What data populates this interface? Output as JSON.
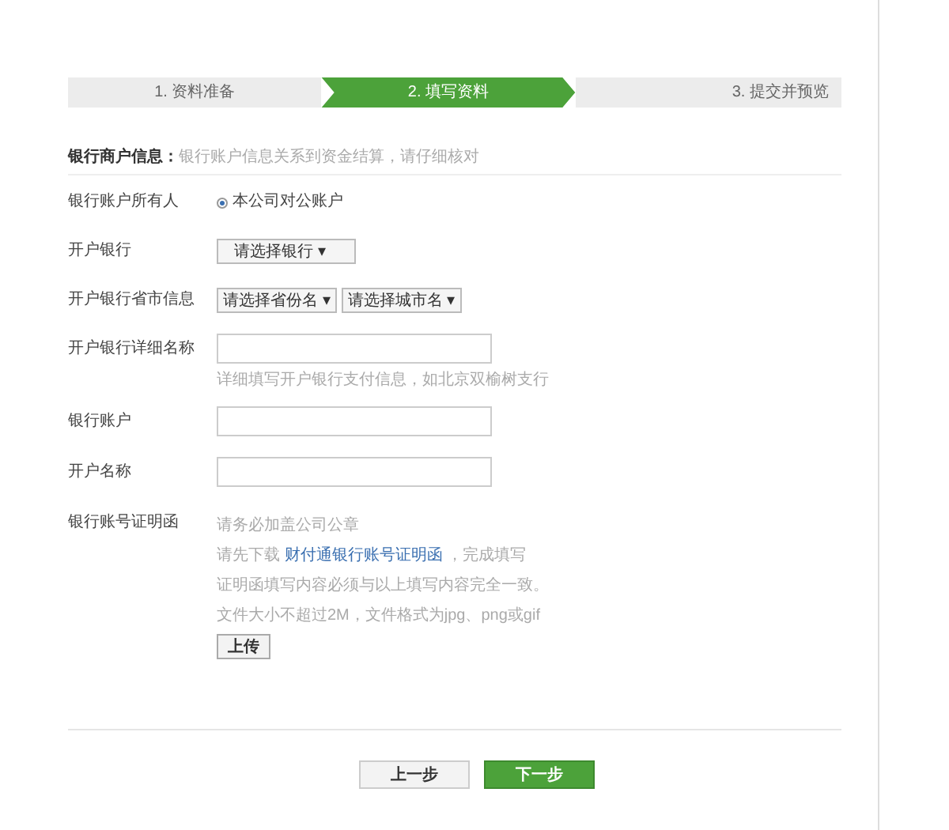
{
  "steps": [
    {
      "label": "1. 资料准备",
      "selected": false
    },
    {
      "label": "2. 填写资料",
      "selected": true
    },
    {
      "label": "3. 提交并预览",
      "selected": false
    }
  ],
  "section": {
    "title": "银行商户信息：",
    "note": "银行账户信息关系到资金结算，请仔细核对"
  },
  "rows": [
    {
      "kind": "radio",
      "label": "银行账户所有人",
      "option": "本公司对公账户",
      "checked": true
    },
    {
      "kind": "select",
      "label": "开户银行",
      "selects": [
        "请选择银行 ▾"
      ]
    },
    {
      "kind": "select",
      "label": "开户银行省市信息",
      "selects": [
        "请选择省份名 ▾",
        "请选择城市名 ▾"
      ]
    },
    {
      "kind": "text",
      "label": "开户银行详细名称",
      "hint": "详细填写开户银行支付信息，如北京双榆树支行"
    },
    {
      "kind": "text",
      "label": "银行账户"
    },
    {
      "kind": "text",
      "label": "开户名称"
    },
    {
      "kind": "file",
      "label": "银行账号证明函",
      "lines": [
        "请务必加盖公司公章",
        {
          "text": "请先下载 ",
          "link": "财付通银行账号证明函",
          "after": " ，完成填写"
        },
        "证明函填写内容必须与以上填写内容完全一致。",
        "文件大小不超过2M，文件格式为jpg、png或gif"
      ],
      "button": "上传"
    }
  ],
  "buttons": [
    {
      "label": "上一步",
      "kind": "secondary"
    },
    {
      "label": "下一步",
      "kind": "primary"
    }
  ]
}
